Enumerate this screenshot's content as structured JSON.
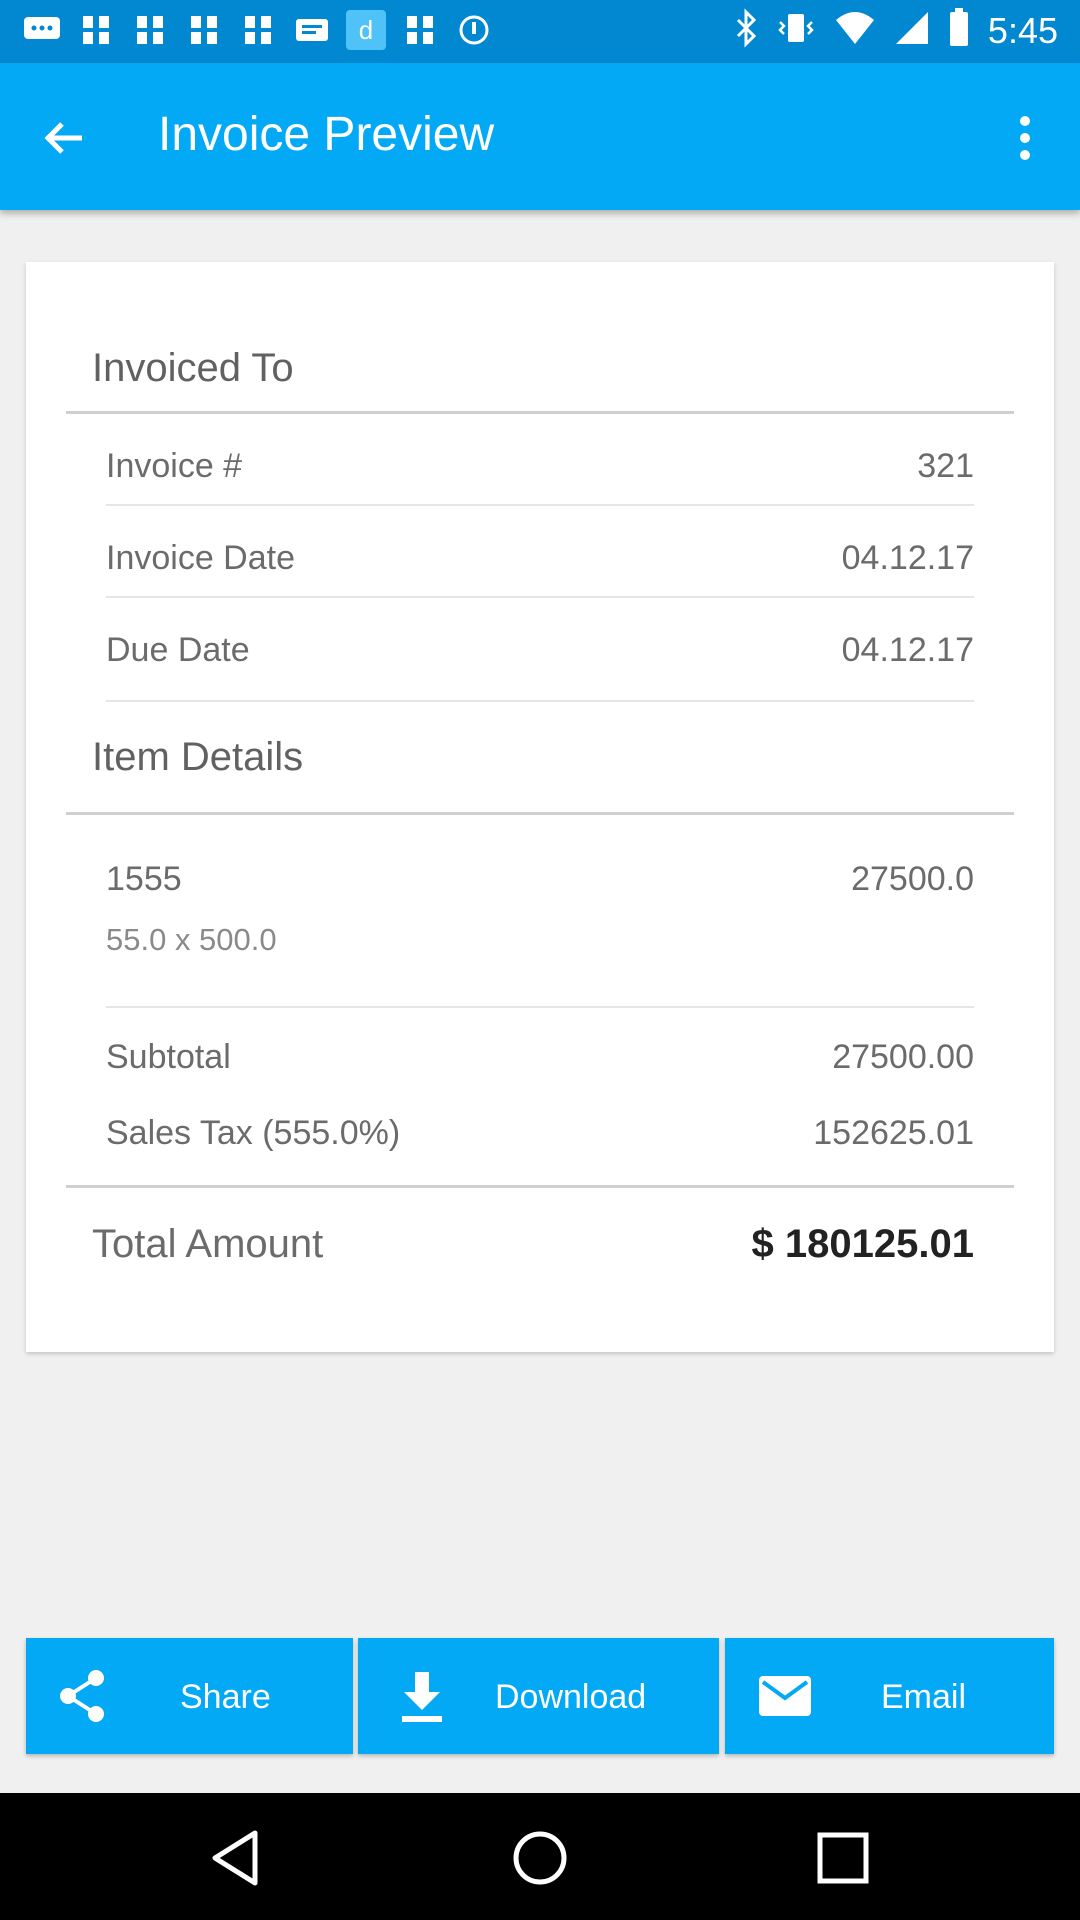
{
  "status_bar": {
    "time": "5:45",
    "left_icons": [
      "message-icon",
      "fan-icon",
      "fan-icon",
      "fan-icon",
      "fan-icon",
      "inbox-icon",
      "app-d-icon",
      "fan-icon",
      "circle-icon"
    ],
    "right_icons": [
      "bluetooth-icon",
      "vibrate-icon",
      "wifi-icon",
      "signal-icon",
      "battery-icon"
    ]
  },
  "app_bar": {
    "title": "Invoice Preview",
    "back_icon": "arrow-back-icon",
    "more_icon": "more-vert-icon"
  },
  "invoice": {
    "invoiced_to_title": "Invoiced To",
    "rows": [
      {
        "label": "Invoice #",
        "value": "321"
      },
      {
        "label": "Invoice Date",
        "value": "04.12.17"
      },
      {
        "label": "Due Date",
        "value": "04.12.17"
      }
    ],
    "item_details_title": "Item Details",
    "item": {
      "name": "1555",
      "amount": "27500.0",
      "calc": "55.0 x 500.0"
    },
    "subtotal_label": "Subtotal",
    "subtotal_value": "27500.00",
    "tax_label": "Sales Tax (555.0%)",
    "tax_value": "152625.01",
    "total_label": "Total Amount",
    "total_value": "$ 180125.01"
  },
  "actions": {
    "share_label": "Share",
    "download_label": "Download",
    "email_label": "Email"
  },
  "colors": {
    "status_bar": "#0288d1",
    "app_bar": "#03a9f4",
    "accent": "#03a9f4",
    "background": "#f0f0f0"
  }
}
